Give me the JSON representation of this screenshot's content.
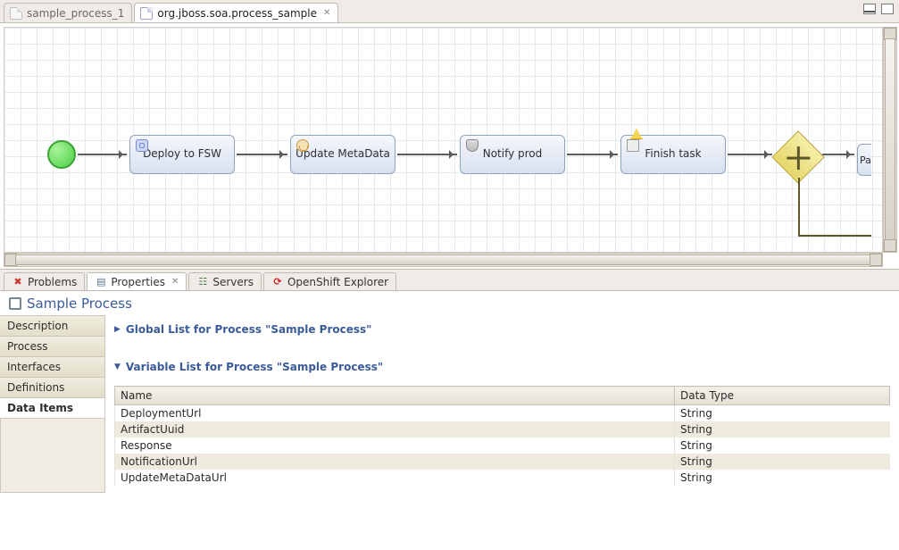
{
  "editor_tabs": {
    "inactive_label": "sample_process_1",
    "active_label": "org.jboss.soa.process_sample"
  },
  "nodes": {
    "task1": "Deploy to FSW",
    "task2": "Update MetaData",
    "task3": "Notify prod",
    "task4": "Finish task",
    "half": "Pas"
  },
  "views": {
    "problems": "Problems",
    "properties": "Properties",
    "servers": "Servers",
    "openshift": "OpenShift Explorer"
  },
  "properties_title": "Sample Process",
  "sidebar_items": {
    "description": "Description",
    "process": "Process",
    "interfaces": "Interfaces",
    "definitions": "Definitions",
    "data_items": "Data Items"
  },
  "sections": {
    "global_list": "Global List for Process \"Sample Process\"",
    "variable_list": "Variable List for Process \"Sample Process\""
  },
  "var_table": {
    "col_name": "Name",
    "col_type": "Data Type",
    "rows": [
      {
        "name": "DeploymentUrl",
        "type": "String"
      },
      {
        "name": "ArtifactUuid",
        "type": "String"
      },
      {
        "name": "Response",
        "type": "String"
      },
      {
        "name": "NotificationUrl",
        "type": "String"
      },
      {
        "name": "UpdateMetaDataUrl",
        "type": "String"
      }
    ]
  }
}
